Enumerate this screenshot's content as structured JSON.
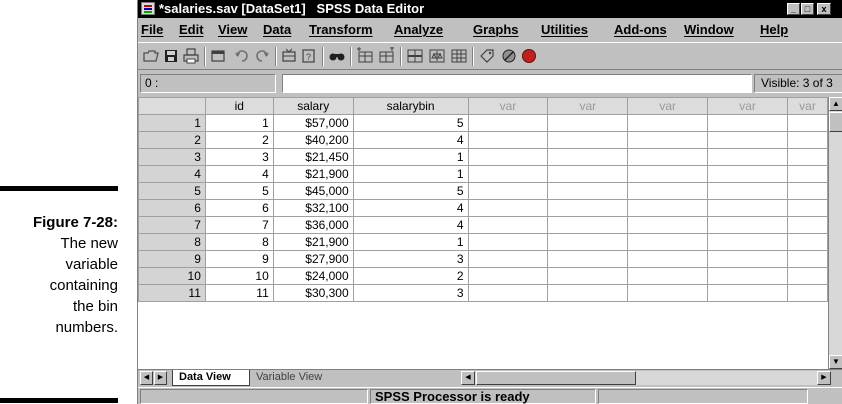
{
  "caption": {
    "label": "Figure 7-28:",
    "lines": [
      "The new",
      "variable",
      "containing",
      "the bin",
      "numbers."
    ]
  },
  "window": {
    "title": "*salaries.sav [DataSet1]   SPSS Data Editor",
    "controls": {
      "minimize": "_",
      "maximize": "□",
      "close": "x"
    }
  },
  "menu": [
    "File",
    "Edit",
    "View",
    "Data",
    "Transform",
    "Analyze",
    "Graphs",
    "Utilities",
    "Add-ons",
    "Window",
    "Help"
  ],
  "toolbar_icons": [
    "open-icon",
    "save-icon",
    "print-icon",
    "dialog-recall-icon",
    "undo-icon",
    "redo-icon",
    "goto-case-icon",
    "variables-icon",
    "find-icon",
    "insert-case-icon",
    "insert-variable-icon",
    "split-file-icon",
    "weight-cases-icon",
    "select-cases-icon",
    "value-labels-icon",
    "use-sets-icon",
    "show-all-icon"
  ],
  "cell_editor": {
    "ref": "0 :",
    "value": "",
    "visible": "Visible: 3 of 3"
  },
  "grid": {
    "columns": [
      "id",
      "salary",
      "salarybin",
      "var",
      "var",
      "var",
      "var",
      "var"
    ],
    "rows": [
      {
        "num": "1",
        "id": "1",
        "salary": "$57,000",
        "salarybin": "5"
      },
      {
        "num": "2",
        "id": "2",
        "salary": "$40,200",
        "salarybin": "4"
      },
      {
        "num": "3",
        "id": "3",
        "salary": "$21,450",
        "salarybin": "1"
      },
      {
        "num": "4",
        "id": "4",
        "salary": "$21,900",
        "salarybin": "1"
      },
      {
        "num": "5",
        "id": "5",
        "salary": "$45,000",
        "salarybin": "5"
      },
      {
        "num": "6",
        "id": "6",
        "salary": "$32,100",
        "salarybin": "4"
      },
      {
        "num": "7",
        "id": "7",
        "salary": "$36,000",
        "salarybin": "4"
      },
      {
        "num": "8",
        "id": "8",
        "salary": "$21,900",
        "salarybin": "1"
      },
      {
        "num": "9",
        "id": "9",
        "salary": "$27,900",
        "salarybin": "3"
      },
      {
        "num": "10",
        "id": "10",
        "salary": "$24,000",
        "salarybin": "2"
      },
      {
        "num": "11",
        "id": "11",
        "salary": "$30,300",
        "salarybin": "3"
      }
    ]
  },
  "tabs": {
    "data_view": "Data View",
    "variable_view": "Variable View"
  },
  "status": {
    "message": "SPSS Processor is ready"
  }
}
